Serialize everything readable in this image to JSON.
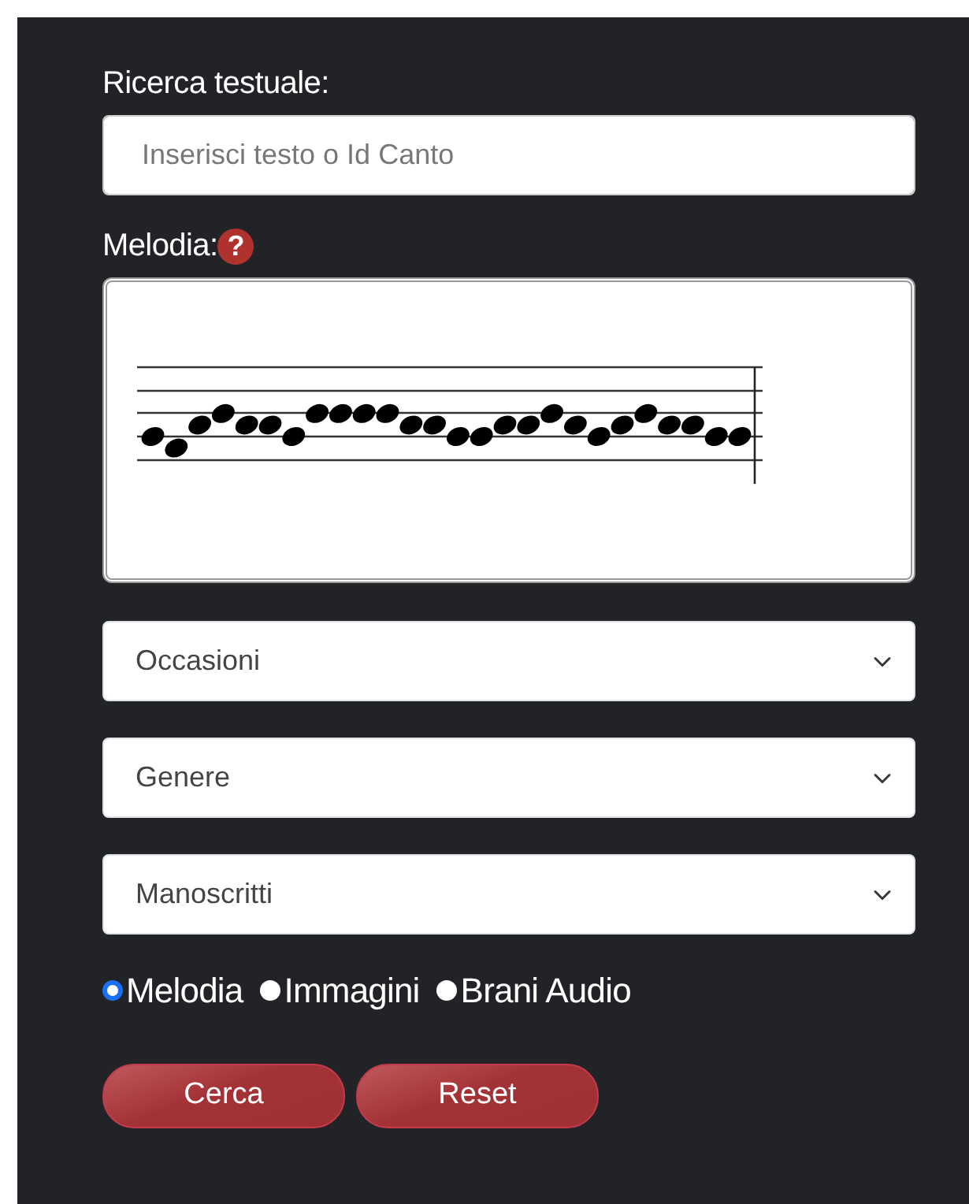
{
  "text_search": {
    "label": "Ricerca testuale:",
    "placeholder": "Inserisci testo o Id Canto"
  },
  "melody": {
    "label": "Melodia:",
    "help": "?"
  },
  "selects": [
    {
      "value": "Occasioni"
    },
    {
      "value": "Genere"
    },
    {
      "value": "Manoscritti"
    }
  ],
  "search_modes": [
    {
      "label": "Melodia",
      "selected": true
    },
    {
      "label": "Immagini",
      "selected": false
    },
    {
      "label": "Brani Audio",
      "selected": false
    }
  ],
  "buttons": [
    {
      "label": "Cerca"
    },
    {
      "label": "Reset"
    }
  ]
}
